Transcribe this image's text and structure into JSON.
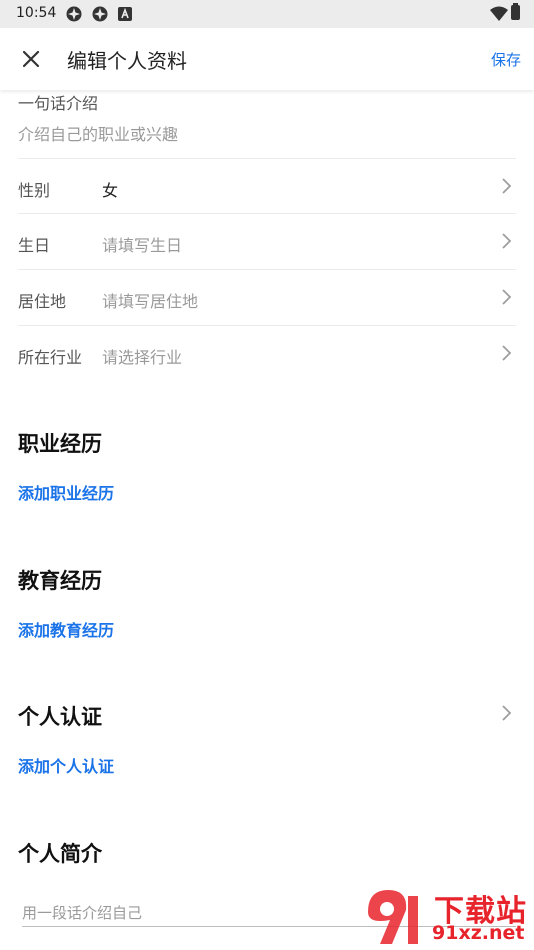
{
  "status_bar": {
    "time": "10:54",
    "icons": [
      "app-notification-icon",
      "app-notification-icon",
      "a-box-icon",
      "wifi-icon",
      "battery-icon"
    ]
  },
  "app_bar": {
    "close_icon": "close-icon",
    "title": "编辑个人资料",
    "save_label": "保存"
  },
  "intro": {
    "label": "一句话介绍",
    "placeholder": "介绍自己的职业或兴趣"
  },
  "fields": [
    {
      "label": "性别",
      "value": "女",
      "is_placeholder": false
    },
    {
      "label": "生日",
      "value": "请填写生日",
      "is_placeholder": true
    },
    {
      "label": "居住地",
      "value": "请填写居住地",
      "is_placeholder": true
    },
    {
      "label": "所在行业",
      "value": "请选择行业",
      "is_placeholder": true
    }
  ],
  "sections": {
    "work": {
      "title": "职业经历",
      "link": "添加职业经历"
    },
    "education": {
      "title": "教育经历",
      "link": "添加教育经历"
    },
    "verification": {
      "title": "个人认证",
      "link": "添加个人认证"
    },
    "bio": {
      "title": "个人简介",
      "placeholder": "用一段话介绍自己"
    }
  },
  "watermark": {
    "line1": "下载站",
    "line2": "91xz.net"
  },
  "colors": {
    "accent": "#1a73e8",
    "watermark": "#e7232b"
  }
}
